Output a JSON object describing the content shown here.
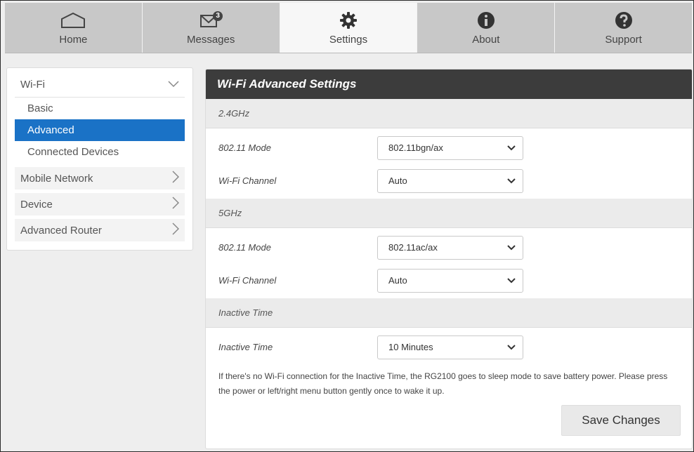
{
  "tabs": {
    "home": {
      "label": "Home",
      "icon": "home-icon"
    },
    "messages": {
      "label": "Messages",
      "icon": "envelope-icon",
      "badge": "3"
    },
    "settings": {
      "label": "Settings",
      "icon": "gear-icon",
      "active": true
    },
    "about": {
      "label": "About",
      "icon": "info-icon"
    },
    "support": {
      "label": "Support",
      "icon": "help-icon"
    }
  },
  "sidebar": {
    "wifi": {
      "label": "Wi-Fi",
      "sub": {
        "basic": "Basic",
        "advanced": "Advanced",
        "connected": "Connected Devices"
      }
    },
    "mobile": "Mobile Network",
    "device": "Device",
    "router": "Advanced Router"
  },
  "panel": {
    "title": "Wi-Fi Advanced Settings",
    "band24": {
      "heading": "2.4GHz",
      "mode_label": "802.11 Mode",
      "mode_value": "802.11bgn/ax",
      "channel_label": "Wi-Fi Channel",
      "channel_value": "Auto"
    },
    "band5": {
      "heading": "5GHz",
      "mode_label": "802.11 Mode",
      "mode_value": "802.11ac/ax",
      "channel_label": "Wi-Fi Channel",
      "channel_value": "Auto"
    },
    "inactive": {
      "heading": "Inactive Time",
      "label": "Inactive Time",
      "value": "10 Minutes",
      "note": "If there's no Wi-Fi connection for the Inactive Time, the RG2100 goes to sleep mode to save battery power. Please press the power or left/right menu button gently once to wake it up."
    },
    "save_label": "Save Changes"
  },
  "colors": {
    "accent": "#1a72c6",
    "title_bar": "#3c3c3c",
    "tab_bar": "#c8c8c8"
  }
}
